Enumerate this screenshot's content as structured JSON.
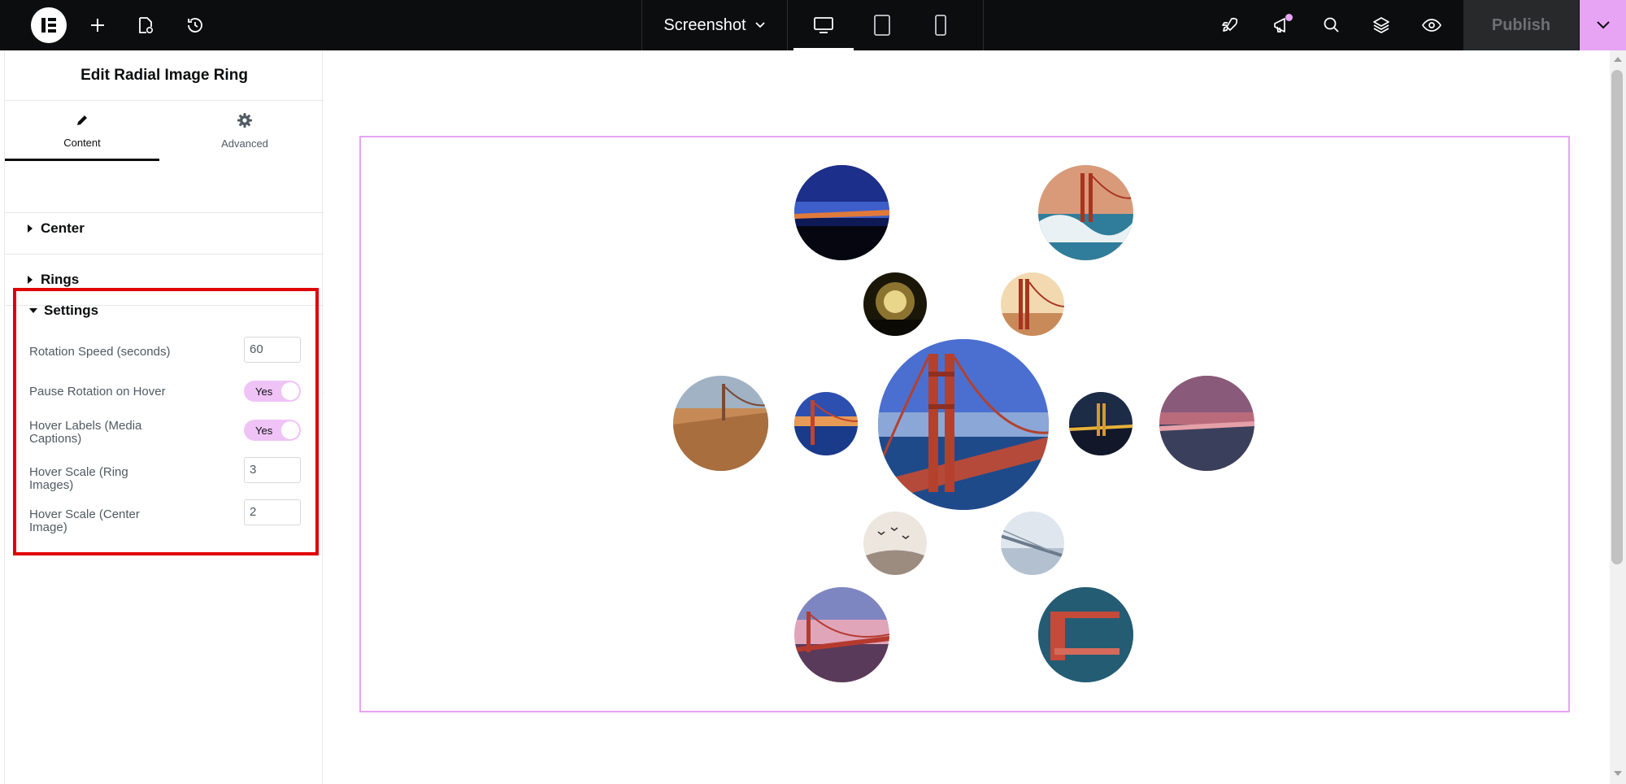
{
  "topbar": {
    "document_name": "Screenshot",
    "publish_label": "Publish",
    "icons": [
      "elementor-logo-icon",
      "plus-icon",
      "page-settings-icon",
      "history-icon",
      "chevron-down-icon",
      "desktop-icon",
      "tablet-icon",
      "mobile-icon",
      "rocket-icon",
      "megaphone-icon",
      "search-icon",
      "layers-icon",
      "eye-icon"
    ]
  },
  "panel": {
    "title": "Edit Radial Image Ring",
    "tabs": [
      {
        "label": "Content",
        "icon": "pencil-icon",
        "active": true
      },
      {
        "label": "Advanced",
        "icon": "gear-icon",
        "active": false
      }
    ],
    "sections": [
      {
        "label": "Center",
        "expanded": false
      },
      {
        "label": "Rings",
        "expanded": false
      },
      {
        "label": "Settings",
        "expanded": true
      }
    ],
    "settings": {
      "rotation_speed_label": "Rotation Speed (seconds)",
      "rotation_speed_value": "60",
      "pause_rotation_label": "Pause Rotation on Hover",
      "pause_rotation_value": "Yes",
      "hover_labels_label": "Hover Labels (Media Captions)",
      "hover_labels_value": "Yes",
      "hover_scale_ring_label": "Hover Scale (Ring Images)",
      "hover_scale_ring_value": "3",
      "hover_scale_center_label": "Hover Scale (Center Image)",
      "hover_scale_center_value": "2"
    }
  },
  "colors": {
    "topbar_bg": "#0c0d0e",
    "accent_pink": "#e7a4f5",
    "toggle_on": "#f0c3f7",
    "highlight_red": "#e00000"
  },
  "canvas": {
    "widget": "radial-image-ring",
    "images": [
      "golden-gate-bridge-center",
      "ring-image-night-city",
      "ring-image-bridge-waves",
      "ring-image-golden-glow",
      "ring-image-sunset-tower",
      "ring-image-hillside-town",
      "ring-image-bridge-sunset",
      "ring-image-bridge-night-lights",
      "ring-image-pink-fog",
      "ring-image-birds",
      "ring-image-fog-bridge",
      "ring-image-pink-sunset-bridge",
      "ring-image-bridge-from-below"
    ]
  }
}
